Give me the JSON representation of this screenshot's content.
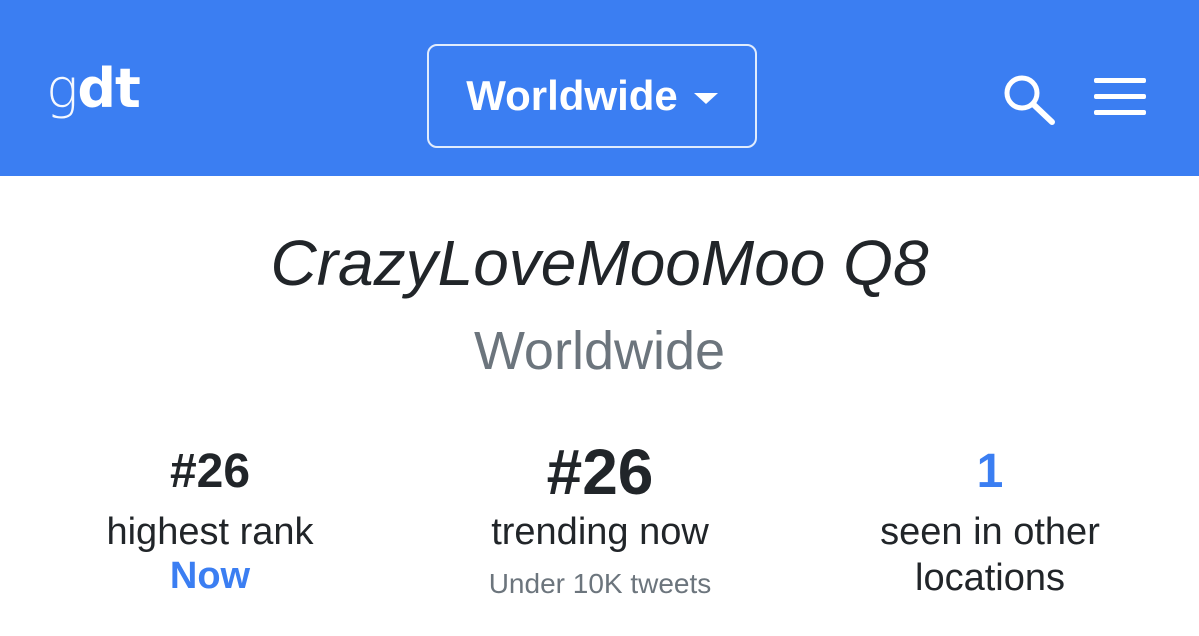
{
  "header": {
    "logo_g": "g",
    "logo_dt": "dt",
    "location_select": "Worldwide",
    "icons": {
      "search": "search-icon",
      "menu": "hamburger-menu-icon"
    },
    "colors": {
      "bar": "#3b7ef2",
      "accent": "#3b7ef2",
      "muted": "#6c757d"
    }
  },
  "trend": {
    "name": "CrazyLoveMooMoo Q8",
    "location": "Worldwide"
  },
  "stats": {
    "highest_rank": {
      "value": "#26",
      "label": "highest rank",
      "when": "Now"
    },
    "trending_now": {
      "value": "#26",
      "label": "trending now",
      "detail": "Under 10K tweets"
    },
    "other_locations": {
      "value": "1",
      "label_line1": "seen in other",
      "label_line2": "locations"
    }
  }
}
